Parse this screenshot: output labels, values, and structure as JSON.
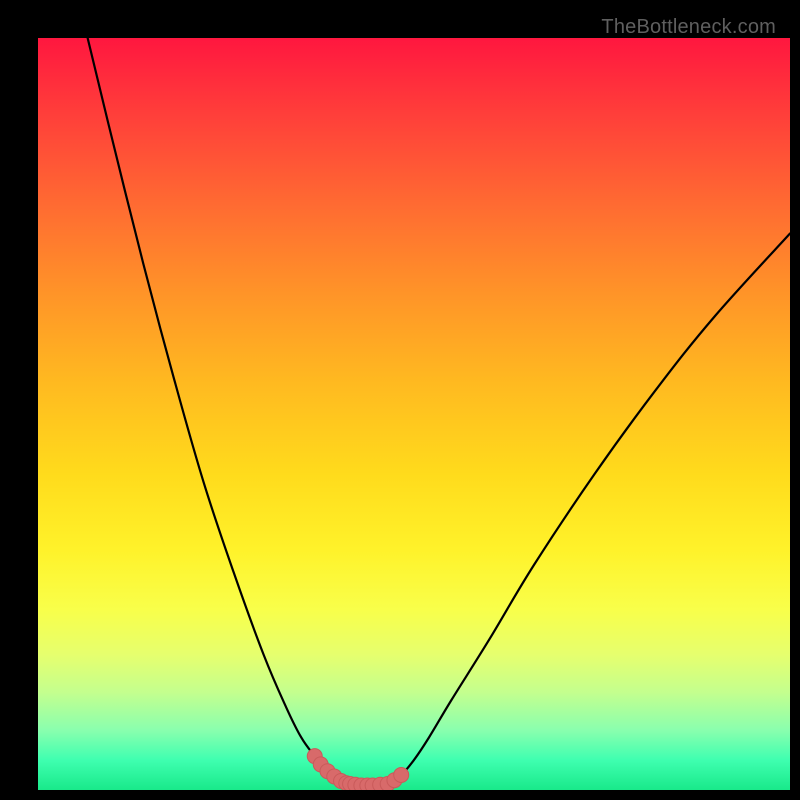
{
  "watermark": "TheBottleneck.com",
  "colors": {
    "curve": "#000000",
    "marker": "#d86a6a",
    "marker_stroke": "#c95a5a"
  },
  "chart_data": {
    "type": "line",
    "title": "",
    "xlabel": "",
    "ylabel": "",
    "xlim": [
      0,
      100
    ],
    "ylim": [
      0,
      100
    ],
    "left_curve": {
      "x": [
        6.6,
        10,
        14,
        18,
        22,
        26,
        30,
        33,
        35,
        36.8,
        38.5,
        40.3,
        41.5
      ],
      "y": [
        100,
        86,
        70,
        55,
        41,
        29,
        18,
        11,
        7,
        4.5,
        2.5,
        1.2,
        0.8
      ]
    },
    "right_curve": {
      "x": [
        46.5,
        48.3,
        50,
        52,
        55,
        60,
        66,
        74,
        82,
        90,
        100
      ],
      "y": [
        0.8,
        2.0,
        4.0,
        7.0,
        12,
        20,
        30,
        42,
        53,
        63,
        74
      ]
    },
    "plateau": {
      "x": [
        41.5,
        43,
        44.5,
        46.5
      ],
      "y": [
        0.8,
        0.6,
        0.6,
        0.8
      ]
    },
    "marker_points": {
      "x": [
        36.8,
        37.6,
        38.5,
        39.4,
        40.3,
        41.0,
        41.5,
        42.2,
        43.0,
        43.8,
        44.5,
        45.5,
        46.5,
        47.4,
        48.3
      ],
      "y": [
        4.5,
        3.4,
        2.5,
        1.8,
        1.2,
        0.9,
        0.8,
        0.7,
        0.6,
        0.6,
        0.6,
        0.7,
        0.8,
        1.3,
        2.0
      ]
    }
  }
}
